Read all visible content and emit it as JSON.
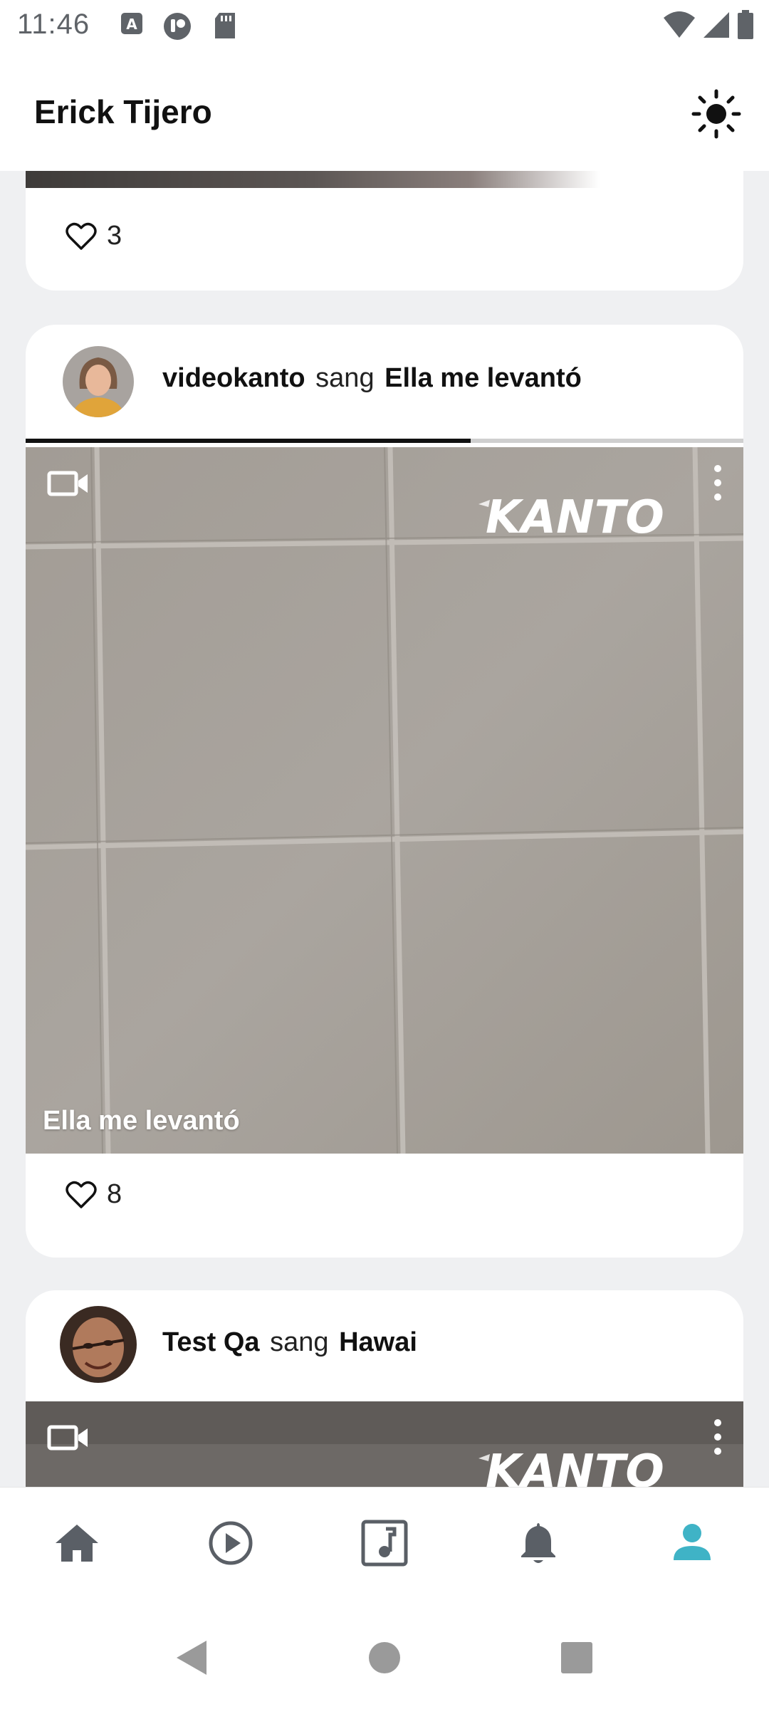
{
  "status_bar": {
    "time": "11:46"
  },
  "header": {
    "title": "Erick Tijero"
  },
  "feed": {
    "cards": [
      {
        "likes": "3"
      },
      {
        "username": "videokanto",
        "verb": "sang",
        "song": "Ella me levantó",
        "progress": 0.62,
        "video_caption": "Ella me levantó",
        "brand": "KANTO",
        "likes": "8"
      },
      {
        "username": "Test Qa",
        "verb": "sang",
        "song": "Hawai",
        "brand": "KANTO"
      }
    ]
  },
  "colors": {
    "accent": "#3fb3c6",
    "nav_inactive": "#5a5f66",
    "background": "#eff0f2"
  },
  "bottom_nav": {
    "items": [
      "home-icon",
      "play-icon",
      "music-note-icon",
      "bell-icon",
      "person-icon"
    ],
    "active": "person-icon"
  }
}
